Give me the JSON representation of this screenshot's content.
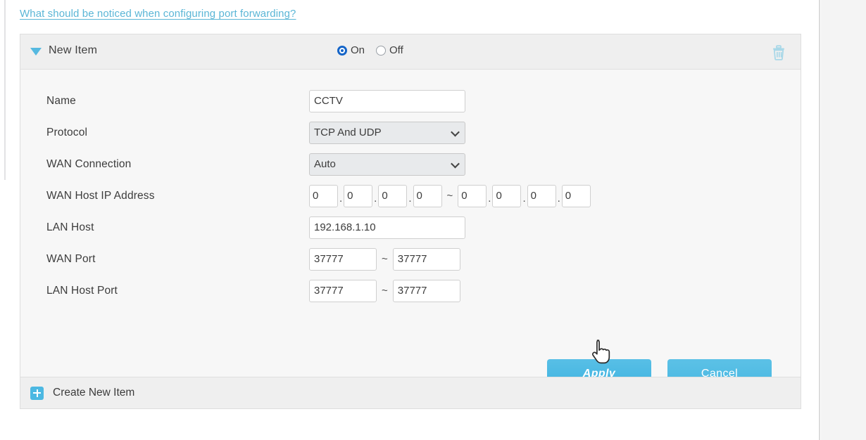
{
  "help_link": {
    "text": "What should be noticed when configuring port forwarding?",
    "color": "#5bb6d6"
  },
  "item": {
    "title": "New Item",
    "disclosure_icon": "triangle-down-icon",
    "delete_icon": "trash-icon",
    "enable_toggle": {
      "selected": "On",
      "options": [
        {
          "label": "On",
          "selected": true
        },
        {
          "label": "Off",
          "selected": false
        }
      ]
    }
  },
  "form": {
    "rows": [
      {
        "label": "Name",
        "type": "text",
        "value": "CCTV"
      },
      {
        "label": "Protocol",
        "type": "select",
        "value": "TCP And UDP"
      },
      {
        "label": "WAN Connection",
        "type": "select",
        "value": "Auto"
      },
      {
        "label": "WAN Host IP Address",
        "type": "ip-range",
        "start": [
          "0",
          "0",
          "0",
          "0"
        ],
        "end": [
          "0",
          "0",
          "0",
          "0"
        ],
        "separator": "~"
      },
      {
        "label": "LAN Host",
        "type": "text",
        "value": "192.168.1.10"
      },
      {
        "label": "WAN Port",
        "type": "range",
        "start": "37777",
        "end": "37777",
        "separator": "~"
      },
      {
        "label": "LAN Host Port",
        "type": "range",
        "start": "37777",
        "end": "37777",
        "separator": "~"
      }
    ]
  },
  "buttons": {
    "apply": "Apply",
    "cancel": "Cancel",
    "accent_color": "#4cb8e2"
  },
  "footer": {
    "create_label": "Create New Item",
    "plus_icon": "plus-icon"
  },
  "cursor": {
    "icon": "pointer-hand-cursor"
  }
}
